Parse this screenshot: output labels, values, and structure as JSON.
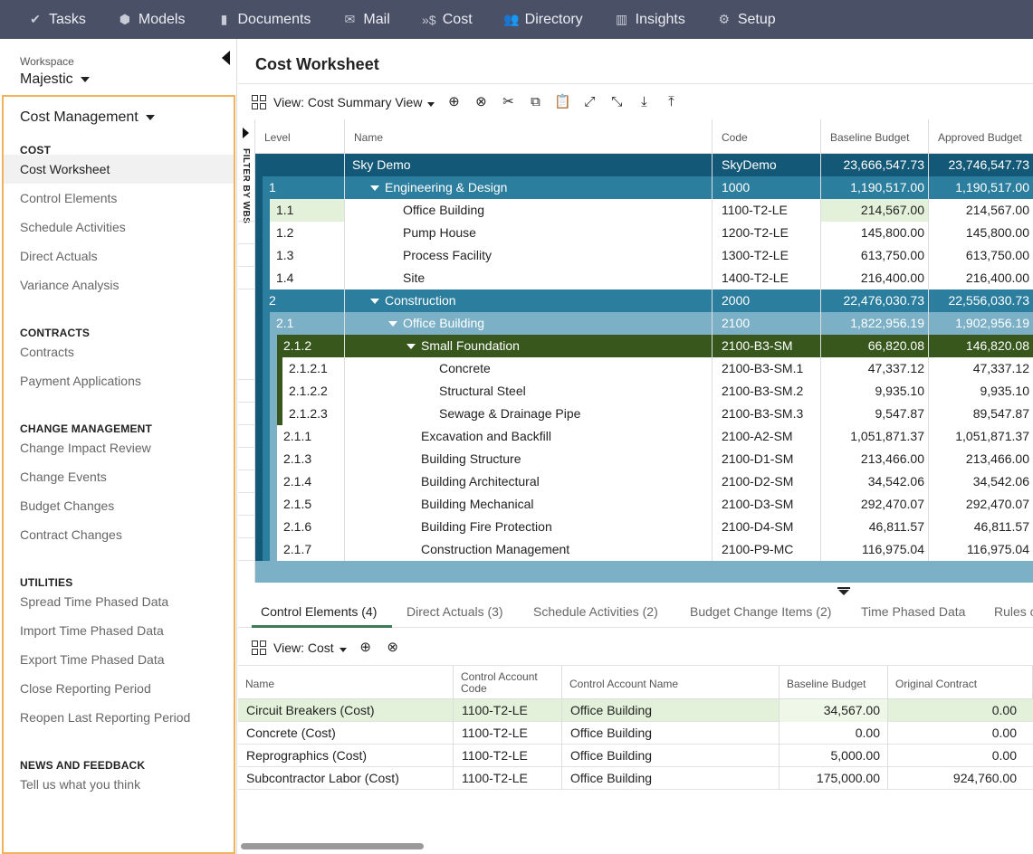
{
  "nav": [
    {
      "label": "Tasks",
      "icon": "check-icon",
      "glyph": "✔"
    },
    {
      "label": "Models",
      "icon": "cube-icon",
      "glyph": "⬢"
    },
    {
      "label": "Documents",
      "icon": "document-icon",
      "glyph": "▮"
    },
    {
      "label": "Mail",
      "icon": "mail-icon",
      "glyph": "✉"
    },
    {
      "label": "Cost",
      "icon": "cost-icon",
      "glyph": "»$"
    },
    {
      "label": "Directory",
      "icon": "people-icon",
      "glyph": "👥"
    },
    {
      "label": "Insights",
      "icon": "bar-chart-icon",
      "glyph": "▥"
    },
    {
      "label": "Setup",
      "icon": "gear-icon",
      "glyph": "⚙"
    }
  ],
  "workspace": {
    "label": "Workspace",
    "value": "Majestic"
  },
  "module": {
    "title": "Cost Management"
  },
  "sections": [
    {
      "heading": "COST",
      "items": [
        "Cost Worksheet",
        "Control Elements",
        "Schedule Activities",
        "Direct Actuals",
        "Variance Analysis"
      ]
    },
    {
      "heading": "CONTRACTS",
      "items": [
        "Contracts",
        "Payment Applications"
      ]
    },
    {
      "heading": "CHANGE MANAGEMENT",
      "items": [
        "Change Impact Review",
        "Change Events",
        "Budget Changes",
        "Contract Changes"
      ]
    },
    {
      "heading": "UTILITIES",
      "items": [
        "Spread Time Phased Data",
        "Import Time Phased Data",
        "Export Time Phased Data",
        "Close Reporting Period",
        "Reopen Last Reporting Period"
      ]
    },
    {
      "heading": "NEWS AND FEEDBACK",
      "items": [
        "Tell us what you think"
      ]
    }
  ],
  "active_item": "Cost Worksheet",
  "page_title": "Cost Worksheet",
  "toolbar": {
    "view_label": "View: Cost Summary View",
    "icons": [
      "add-icon",
      "remove-icon",
      "cut-icon",
      "copy-icon",
      "paste-icon",
      "expand-icon",
      "collapse-icon",
      "download-icon",
      "upload-icon"
    ]
  },
  "filter_label": "FILTER BY WBS",
  "worksheet": {
    "columns": [
      "Level",
      "Name",
      "Code",
      "Baseline Budget",
      "Approved Budget"
    ],
    "rows": [
      {
        "level": "",
        "name": "Sky Demo",
        "code": "SkyDemo",
        "baseline": "23,666,547.73",
        "approved": "23,746,547.73",
        "style": "root",
        "indent": 0,
        "toggle": false
      },
      {
        "level": "1",
        "name": "Engineering & Design",
        "code": "1000",
        "baseline": "1,190,517.00",
        "approved": "1,190,517.00",
        "style": "l1",
        "indent": 1,
        "toggle": true
      },
      {
        "level": "1.1",
        "name": "Office Building",
        "code": "1100-T2-LE",
        "baseline": "214,567.00",
        "approved": "214,567.00",
        "style": "sel",
        "indent": 2,
        "toggle": false
      },
      {
        "level": "1.2",
        "name": "Pump House",
        "code": "1200-T2-LE",
        "baseline": "145,800.00",
        "approved": "145,800.00",
        "style": "leaf1",
        "indent": 2,
        "toggle": false
      },
      {
        "level": "1.3",
        "name": "Process Facility",
        "code": "1300-T2-LE",
        "baseline": "613,750.00",
        "approved": "613,750.00",
        "style": "leaf1",
        "indent": 2,
        "toggle": false
      },
      {
        "level": "1.4",
        "name": "Site",
        "code": "1400-T2-LE",
        "baseline": "216,400.00",
        "approved": "216,400.00",
        "style": "leaf1",
        "indent": 2,
        "toggle": false
      },
      {
        "level": "2",
        "name": "Construction",
        "code": "2000",
        "baseline": "22,476,030.73",
        "approved": "22,556,030.73",
        "style": "l1",
        "indent": 1,
        "toggle": true
      },
      {
        "level": "2.1",
        "name": "Office Building",
        "code": "2100",
        "baseline": "1,822,956.19",
        "approved": "1,902,956.19",
        "style": "l2",
        "indent": 2,
        "toggle": true
      },
      {
        "level": "2.1.2",
        "name": "Small Foundation",
        "code": "2100-B3-SM",
        "baseline": "66,820.08",
        "approved": "146,820.08",
        "style": "l3",
        "indent": 3,
        "toggle": true
      },
      {
        "level": "2.1.2.1",
        "name": "Concrete",
        "code": "2100-B3-SM.1",
        "baseline": "47,337.12",
        "approved": "47,337.12",
        "style": "leaf3",
        "indent": 4,
        "toggle": false
      },
      {
        "level": "2.1.2.2",
        "name": "Structural Steel",
        "code": "2100-B3-SM.2",
        "baseline": "9,935.10",
        "approved": "9,935.10",
        "style": "leaf3",
        "indent": 4,
        "toggle": false
      },
      {
        "level": "2.1.2.3",
        "name": "Sewage & Drainage Pipe",
        "code": "2100-B3-SM.3",
        "baseline": "9,547.87",
        "approved": "89,547.87",
        "style": "leaf3",
        "indent": 4,
        "toggle": false
      },
      {
        "level": "2.1.1",
        "name": "Excavation and Backfill",
        "code": "2100-A2-SM",
        "baseline": "1,051,871.37",
        "approved": "1,051,871.37",
        "style": "leaf2",
        "indent": 3,
        "toggle": false
      },
      {
        "level": "2.1.3",
        "name": "Building Structure",
        "code": "2100-D1-SM",
        "baseline": "213,466.00",
        "approved": "213,466.00",
        "style": "leaf2",
        "indent": 3,
        "toggle": false
      },
      {
        "level": "2.1.4",
        "name": "Building Architectural",
        "code": "2100-D2-SM",
        "baseline": "34,542.06",
        "approved": "34,542.06",
        "style": "leaf2",
        "indent": 3,
        "toggle": false
      },
      {
        "level": "2.1.5",
        "name": "Building Mechanical",
        "code": "2100-D3-SM",
        "baseline": "292,470.07",
        "approved": "292,470.07",
        "style": "leaf2",
        "indent": 3,
        "toggle": false
      },
      {
        "level": "2.1.6",
        "name": "Building Fire Protection",
        "code": "2100-D4-SM",
        "baseline": "46,811.57",
        "approved": "46,811.57",
        "style": "leaf2",
        "indent": 3,
        "toggle": false
      },
      {
        "level": "2.1.7",
        "name": "Construction Management",
        "code": "2100-P9-MC",
        "baseline": "116,975.04",
        "approved": "116,975.04",
        "style": "leaf2",
        "indent": 3,
        "toggle": false
      }
    ]
  },
  "tabs": [
    "Control Elements (4)",
    "Direct Actuals (3)",
    "Schedule Activities (2)",
    "Budget Change Items (2)",
    "Time Phased Data",
    "Rules c"
  ],
  "lower_toolbar": {
    "view_label": "View: Cost"
  },
  "control_elements": {
    "columns": [
      "Name",
      "Control Account Code",
      "Control Account Name",
      "Baseline Budget",
      "Original Contract"
    ],
    "rows": [
      {
        "name": "Circuit Breakers (Cost)",
        "code": "1100-T2-LE",
        "account": "Office Building",
        "baseline": "34,567.00",
        "original": "0.00",
        "selected": true
      },
      {
        "name": "Concrete (Cost)",
        "code": "1100-T2-LE",
        "account": "Office Building",
        "baseline": "0.00",
        "original": "0.00",
        "selected": false
      },
      {
        "name": "Reprographics (Cost)",
        "code": "1100-T2-LE",
        "account": "Office Building",
        "baseline": "5,000.00",
        "original": "0.00",
        "selected": false
      },
      {
        "name": "Subcontractor Labor (Cost)",
        "code": "1100-T2-LE",
        "account": "Office Building",
        "baseline": "175,000.00",
        "original": "924,760.00",
        "selected": false
      }
    ]
  },
  "colors": {
    "nav_bg": "#4a5066",
    "root": "#135977",
    "l1": "#2c7e9e",
    "l2": "#7bb0c7",
    "l3": "#37571d",
    "selected": "#e3f1da",
    "accent": "#3d7a57",
    "highlight_border": "#f0b35a"
  }
}
